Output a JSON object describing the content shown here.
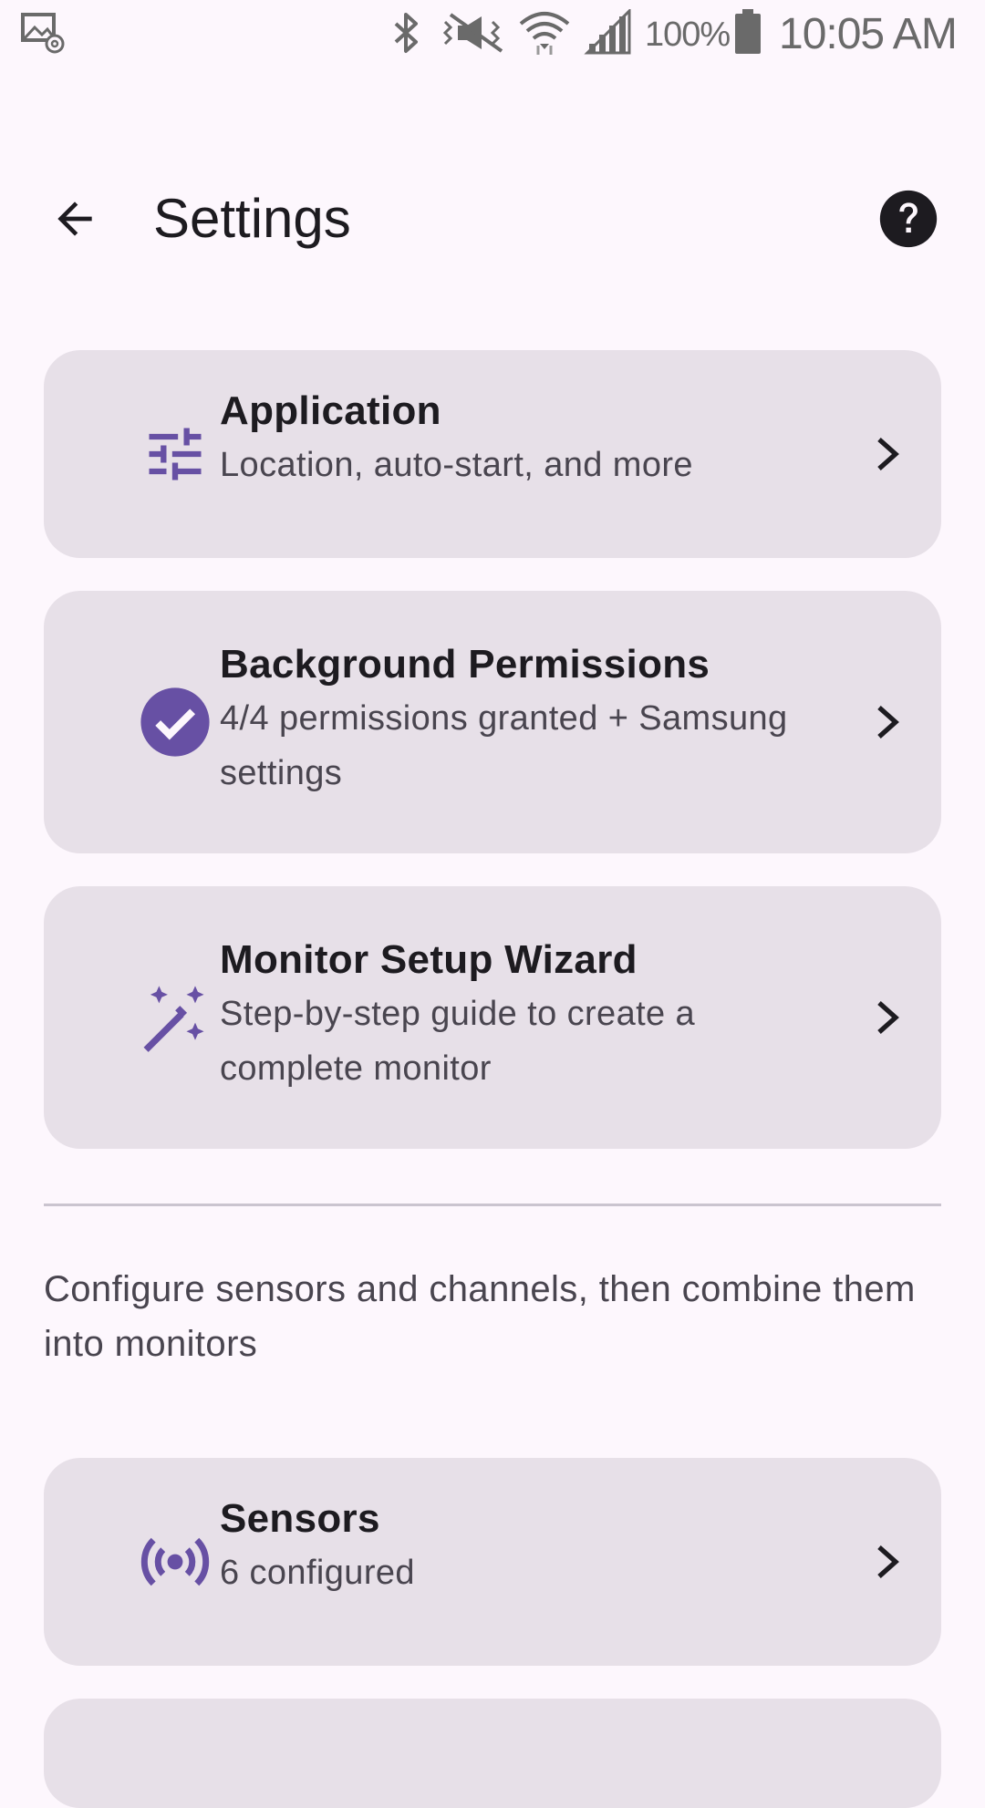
{
  "status_bar": {
    "battery_percent": "100%",
    "time": "10:05 AM",
    "icons": [
      "notification-icon",
      "bluetooth-icon",
      "mute-icon",
      "wifi-icon",
      "signal-icon",
      "battery-icon"
    ]
  },
  "app_bar": {
    "title": "Settings",
    "back_icon": "arrow-back-icon",
    "help_icon": "help-icon"
  },
  "cards": {
    "application": {
      "icon": "tune-icon",
      "title": "Application",
      "subtitle": "Location, auto-start, and more"
    },
    "background_permissions": {
      "icon": "check-circle-icon",
      "title": "Background Permissions",
      "subtitle": "4/4 permissions granted + Samsung settings"
    },
    "monitor_setup_wizard": {
      "icon": "magic-wand-icon",
      "title": "Monitor Setup Wizard",
      "subtitle": "Step-by-step guide to create a complete monitor"
    },
    "sensors": {
      "icon": "sensors-icon",
      "title": "Sensors",
      "subtitle": "6 configured"
    }
  },
  "section": {
    "description": "Configure sensors and channels, then combine them into monitors"
  },
  "colors": {
    "background": "#fdf7fd",
    "card": "#e7e0e8",
    "accent": "#6750a4",
    "title_text": "#1d1b20",
    "secondary_text": "#49454f"
  }
}
